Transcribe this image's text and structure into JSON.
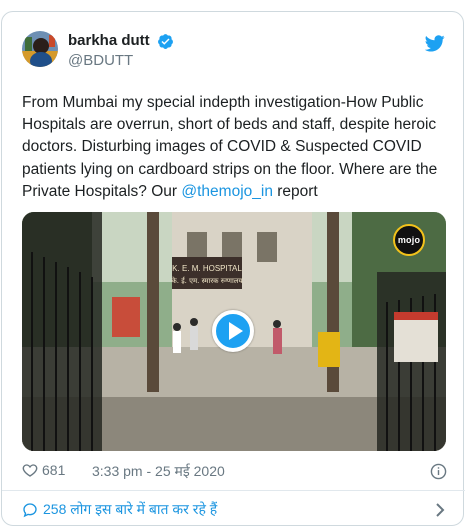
{
  "tweet": {
    "author": {
      "display_name": "barkha dutt",
      "handle": "@BDUTT",
      "verified": true
    },
    "text_before_mention": "From Mumbai my special indepth investigation-How Public Hospitals are overrun, short of beds and staff, despite heroic doctors. Disturbing images of COVID & Suspected COVID patients lying on cardboard strips on the floor. Where are the Private Hospitals? Our ",
    "mention": "@themojo_in",
    "text_after_mention": " report",
    "media": {
      "type": "video",
      "sign_line1": "K. E. M. HOSPITAL",
      "sign_line2": "के. ई. एम. स्मारक रुग्णालय",
      "logo_text": "mojo"
    },
    "likes": "681",
    "timestamp": "3:33 pm - 25 मई 2020",
    "footer_text": "258 लोग इस बारे में बात कर रहे हैं"
  },
  "colors": {
    "link": "#1b95e0",
    "verified": "#1da1f2",
    "play_button": "#1da1f2",
    "muted": "#697882"
  },
  "icons": [
    "twitter-bird-icon",
    "verified-badge-icon",
    "play-icon",
    "heart-icon",
    "info-icon",
    "reply-icon",
    "chevron-right-icon"
  ]
}
